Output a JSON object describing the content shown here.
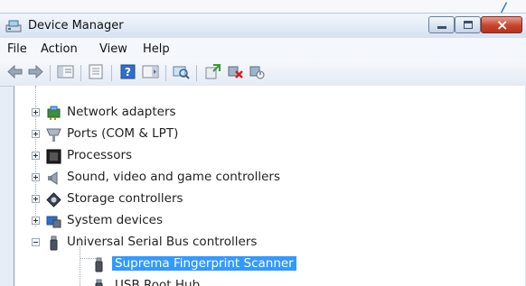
{
  "window": {
    "title": "Device Manager",
    "icon": "device-manager-icon",
    "controls": [
      "minimize-icon",
      "maximize-icon",
      "close-icon"
    ]
  },
  "menu": {
    "items": [
      "File",
      "Action",
      "View",
      "Help"
    ]
  },
  "toolbar": {
    "buttons": [
      "back-icon",
      "forward-icon",
      "show-hide-tree-icon",
      "properties-icon",
      "help-icon",
      "action-pane-icon",
      "scan-hardware-icon",
      "update-driver-icon",
      "uninstall-icon",
      "disable-device-icon"
    ]
  },
  "tree": {
    "items": [
      {
        "label": "Network adapters",
        "icon": "network-adapter-icon"
      },
      {
        "label": "Ports (COM & LPT)",
        "icon": "port-icon"
      },
      {
        "label": "Processors",
        "icon": "processor-icon"
      },
      {
        "label": "Sound, video and game controllers",
        "icon": "speaker-icon"
      },
      {
        "label": "Storage controllers",
        "icon": "storage-icon"
      },
      {
        "label": "System devices",
        "icon": "system-devices-icon"
      },
      {
        "label": "Universal Serial Bus controllers",
        "icon": "usb-icon"
      }
    ],
    "child_selected": {
      "label": "Suprema Fingerprint Scanner",
      "icon": "usb-device-icon"
    },
    "child_partial": {
      "label": "USB Root Hub",
      "icon": "usb-device-icon"
    }
  },
  "colors": {
    "selection": "#3399ff",
    "close_button": "#c5442e",
    "window_frame": "#e6edf7"
  }
}
